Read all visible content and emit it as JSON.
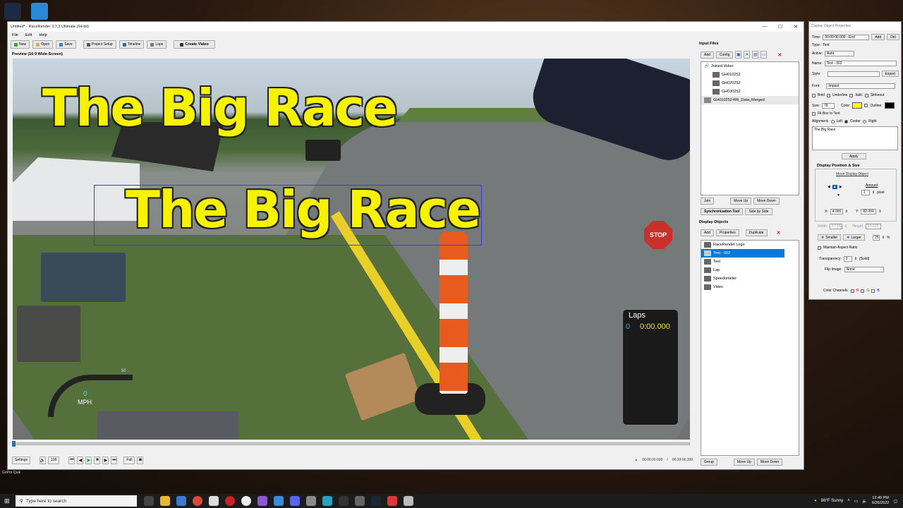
{
  "desktop": {
    "icons": [
      {
        "name": "fastrace-app-icon",
        "color": "#1d2a44"
      },
      {
        "name": "chart-app-icon",
        "color": "#2a88d8"
      }
    ],
    "label": "GoPro Quik"
  },
  "window": {
    "title": "Untitled* - RaceRender 3.7.3 Ultimate (64-bit)",
    "controls": [
      "—",
      "☐",
      "✕"
    ],
    "menu": [
      "File",
      "Edit",
      "Help"
    ],
    "toolbar": [
      "New",
      "Open",
      "Save",
      "Project Setup",
      "Timeline",
      "Laps",
      "Create Video"
    ],
    "preview_label": "Preview (16:9 Wide-Screen)"
  },
  "preview": {
    "title_text_1": "The Big Race",
    "title_text_2": "The Big Race",
    "stop_sign": "STOP",
    "laps": {
      "title": "Laps",
      "count": "0",
      "time": "0:00.000"
    },
    "speedometer": {
      "value": "0",
      "unit": "MPH",
      "max_label": "50"
    }
  },
  "transport": {
    "settings": "Settings",
    "volume": "100",
    "full": "Full",
    "current_time": "00:00:00.000",
    "total_time": "00:19:06.399"
  },
  "input_files": {
    "heading": "Input Files",
    "buttons": [
      "Add",
      "Config"
    ],
    "items": [
      {
        "label": "Joined Video",
        "level": 0
      },
      {
        "label": "GH010252",
        "level": 1
      },
      {
        "label": "GH020252",
        "level": 1
      },
      {
        "label": "GH030252",
        "level": 1
      },
      {
        "label": "GH010252-RR_Data_Merged",
        "level": 0
      }
    ],
    "bottom_buttons": [
      "Join",
      "Move Up",
      "Move Down"
    ],
    "sync_button": "Synchronization Tool",
    "side_button": "Side by Side"
  },
  "display_objects": {
    "heading": "Display Objects",
    "buttons": [
      "Add",
      "Properties",
      "Duplicate"
    ],
    "items": [
      {
        "label": "RaceRender Logo",
        "selected": false
      },
      {
        "label": "Text - 002",
        "selected": true
      },
      {
        "label": "Text",
        "selected": false
      },
      {
        "label": "Lap",
        "selected": false
      },
      {
        "label": "Speedometer",
        "selected": false
      },
      {
        "label": "Video",
        "selected": false
      }
    ],
    "bottom_buttons": [
      "Group",
      "Move Up",
      "Move Down"
    ]
  },
  "properties": {
    "title": "Display Object Properties",
    "time_label": "Time:",
    "time_value": "00:00:00.000 - End",
    "add": "Add",
    "del": "Del",
    "type_label": "Type:",
    "type_value": "Text",
    "active_label": "Active:",
    "active_value": "Auto",
    "name_label": "Name:",
    "name_value": "Text - 002",
    "style_label": "Style:",
    "export": "Export",
    "font_label": "Font:",
    "font_value": "Impact",
    "bold": "Bold",
    "underline": "Underline",
    "italic": "Italic",
    "strikeout": "Strikeout",
    "size_label": "Size:",
    "size_value": "78",
    "color_label": "Color:",
    "outline_label": "Outline:",
    "text_color": "#ffff00",
    "outline_color": "#000000",
    "fit_box": "Fit Box to Text",
    "alignment_label": "Alignment:",
    "align_left": "Left",
    "align_center": "Center",
    "align_right": "Right",
    "text_value": "The Big Race",
    "apply": "Apply",
    "position_heading": "Display Position & Size",
    "move_link": "Move Display Object",
    "amount_label": "Amount",
    "amount_value": "1",
    "pixel": "pixel",
    "x_label": "X:",
    "x_value": "4.000",
    "y_label": "Y:",
    "y_value": "82.000",
    "width_label": "Width:",
    "width_value": "57.153",
    "height_label": "Height:",
    "height_value": "15.625",
    "smaller": "Smaller",
    "larger": "Larger",
    "percent_value": "25",
    "percent": "%",
    "maintain_aspect": "Maintain Aspect Ratio",
    "transparency_label": "Transparency:",
    "transparency_value": "0",
    "solid": "(Solid)",
    "flip_label": "Flip Image:",
    "flip_value": "None",
    "color_channels": "Color Channels:",
    "r": "R",
    "g": "G",
    "b": "B"
  },
  "taskbar": {
    "search_placeholder": "Type here to search",
    "weather": "86°F Sunny",
    "time": "12:40 PM",
    "date": "6/26/2022"
  }
}
